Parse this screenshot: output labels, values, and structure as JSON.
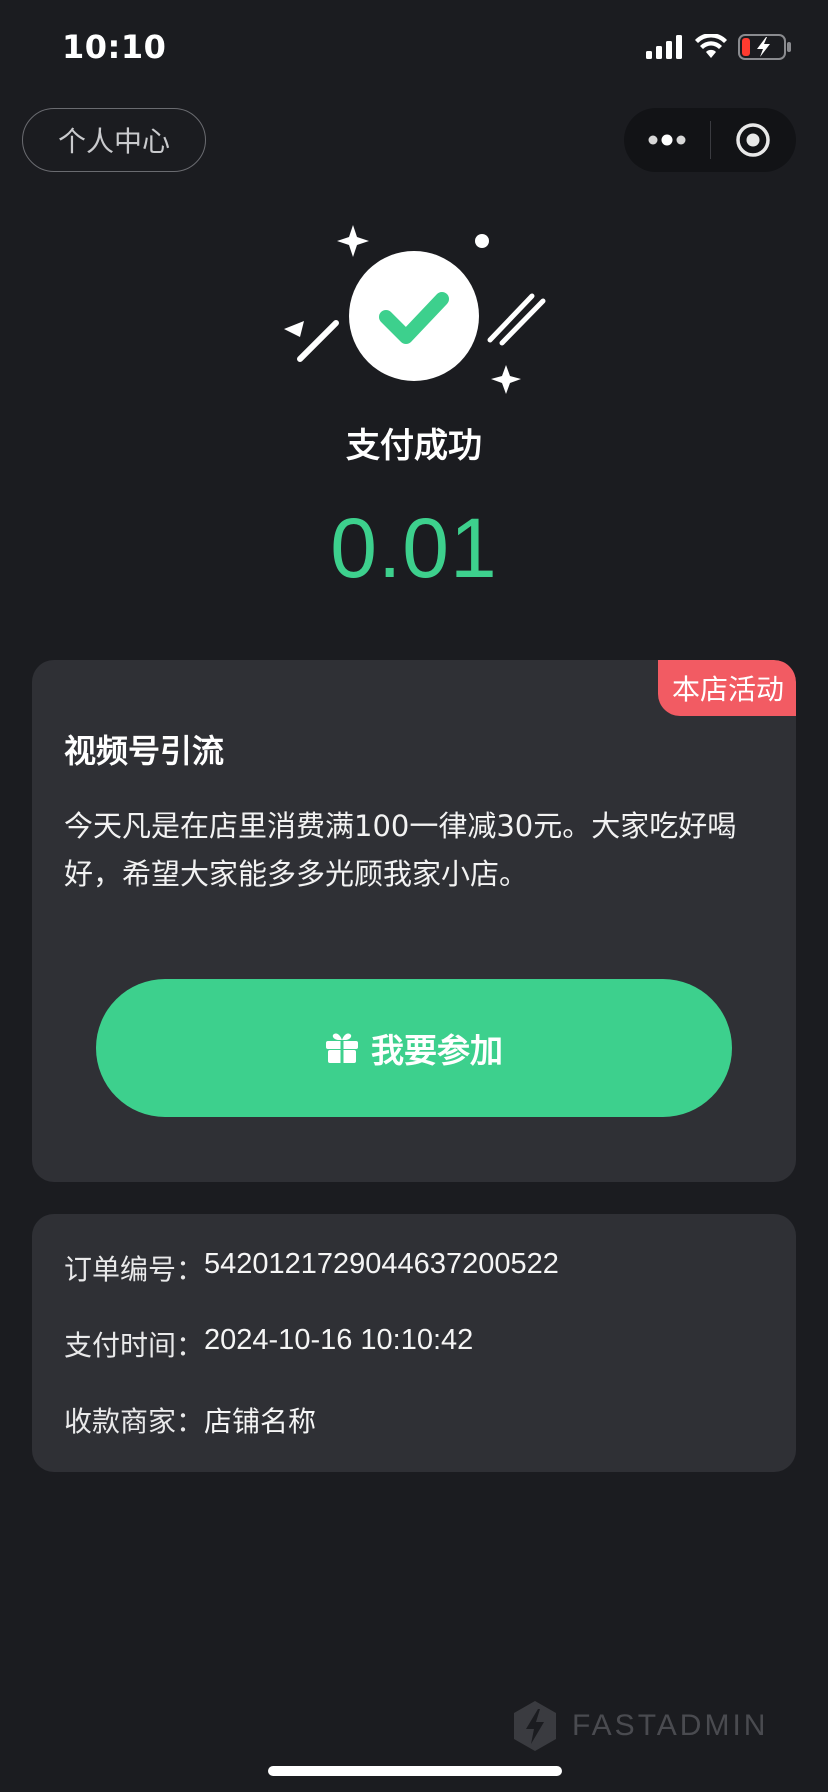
{
  "status_bar": {
    "time": "10:10"
  },
  "nav": {
    "personal_center": "个人中心"
  },
  "success": {
    "title": "支付成功",
    "amount": "0.01"
  },
  "activity": {
    "tag": "本店活动",
    "title": "视频号引流",
    "description": "今天凡是在店里消费满100一律减30元。大家吃好喝好，希望大家能多多光顾我家小店。",
    "join_label": "我要参加"
  },
  "order": {
    "rows": [
      {
        "key": "订单编号：",
        "value": "542012172904463720052​2"
      },
      {
        "key": "支付时间：",
        "value": "2024-10-16 10:10:42"
      },
      {
        "key": "收款商家：",
        "value": "店铺名称"
      }
    ]
  },
  "footer": {
    "brand": "FASTADMIN"
  },
  "colors": {
    "accent_green": "#3dd08d",
    "tag_red": "#f25b63",
    "card_bg": "#2f3035",
    "page_bg": "#1b1c20"
  }
}
